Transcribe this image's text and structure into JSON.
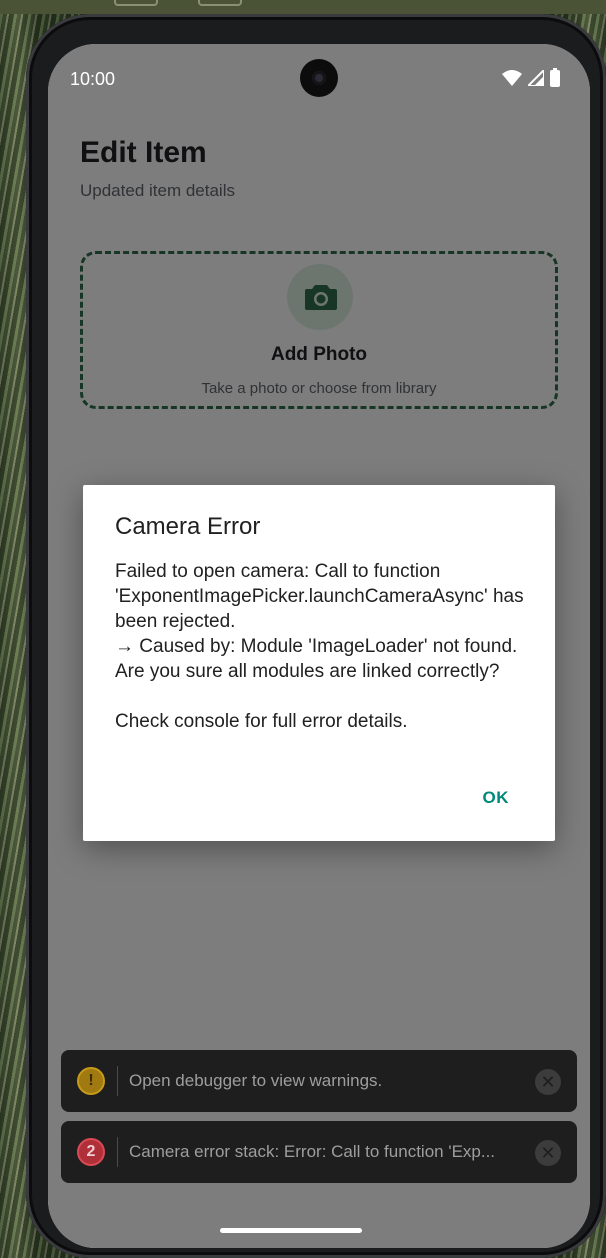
{
  "status_bar": {
    "time": "10:00"
  },
  "screen": {
    "title": "Edit Item",
    "subtitle": "Updated item details",
    "photo": {
      "title": "Add Photo",
      "subtitle": "Take a photo or choose from library"
    }
  },
  "dialog": {
    "title": "Camera Error",
    "message": "Failed to open camera: Call to function 'ExponentImagePicker.launchCameraAsync' has been rejected.\n→ Caused by: Module 'ImageLoader' not found. Are you sure all modules are linked correctly?\n\nCheck console for full error details.",
    "ok_label": "OK"
  },
  "toasts": [
    {
      "badge": "!",
      "text": "Open debugger to view warnings.",
      "kind": "warning"
    },
    {
      "badge": "2",
      "text": "Camera error stack: Error: Call to function 'Exp...",
      "kind": "error"
    }
  ],
  "colors": {
    "accent": "#00897b",
    "photo_border": "#2e6b4a",
    "warning": "#c79a1a",
    "error": "#d94a55"
  }
}
